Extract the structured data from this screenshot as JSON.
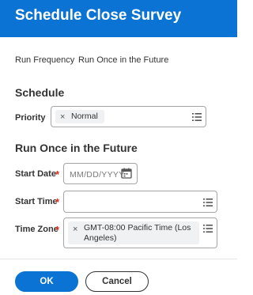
{
  "header": {
    "title": "Schedule Close Survey"
  },
  "run_frequency": {
    "label": "Run Frequency",
    "value": "Run Once in the Future"
  },
  "schedule": {
    "heading": "Schedule",
    "priority": {
      "label": "Priority",
      "selected": "Normal",
      "remove_glyph": "×"
    }
  },
  "run_once": {
    "heading": "Run Once in the Future",
    "required_marker": "*",
    "start_date": {
      "label": "Start Date",
      "placeholder": "MM/DD/YYYY"
    },
    "start_time": {
      "label": "Start Time",
      "value": ""
    },
    "time_zone": {
      "label": "Time Zone",
      "selected": "GMT-08:00 Pacific Time (Los Angeles)",
      "remove_glyph": "×"
    }
  },
  "footer": {
    "ok_label": "OK",
    "cancel_label": "Cancel"
  },
  "colors": {
    "accent": "#0b73d3",
    "required": "#de2e21",
    "pill_bg": "#f0f1f2"
  },
  "icons": {
    "list": "list-icon",
    "calendar": "calendar-icon",
    "remove": "close-icon"
  }
}
